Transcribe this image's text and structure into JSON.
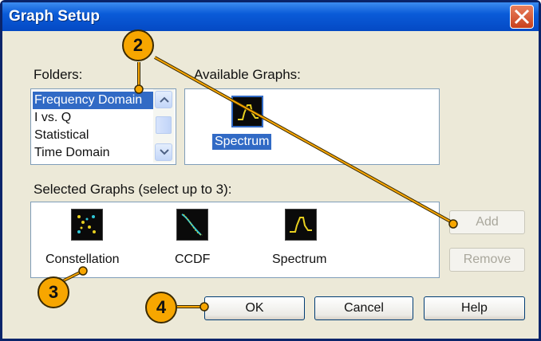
{
  "window": {
    "title": "Graph Setup"
  },
  "folders": {
    "label": "Folders:",
    "items": [
      "Frequency Domain",
      "I vs. Q",
      "Statistical",
      "Time Domain"
    ],
    "selected_index": 0
  },
  "available": {
    "label": "Available Graphs:",
    "items": [
      {
        "label": "Spectrum",
        "icon": "spectrum-graph-icon"
      }
    ]
  },
  "selected": {
    "label": "Selected Graphs (select up to 3):",
    "items": [
      {
        "label": "Constellation",
        "icon": "constellation-graph-icon"
      },
      {
        "label": "CCDF",
        "icon": "ccdf-graph-icon"
      },
      {
        "label": "Spectrum",
        "icon": "spectrum-graph-icon"
      }
    ]
  },
  "buttons": {
    "add": "Add",
    "remove": "Remove",
    "ok": "OK",
    "cancel": "Cancel",
    "help": "Help"
  },
  "callouts": [
    "2",
    "3",
    "4"
  ],
  "colors": {
    "titlebar": "#0A5BD8",
    "selection": "#316AC5",
    "callout": "#F7A600",
    "trace_yellow": "#E8D020",
    "trace_cyan": "#30C8D8"
  }
}
